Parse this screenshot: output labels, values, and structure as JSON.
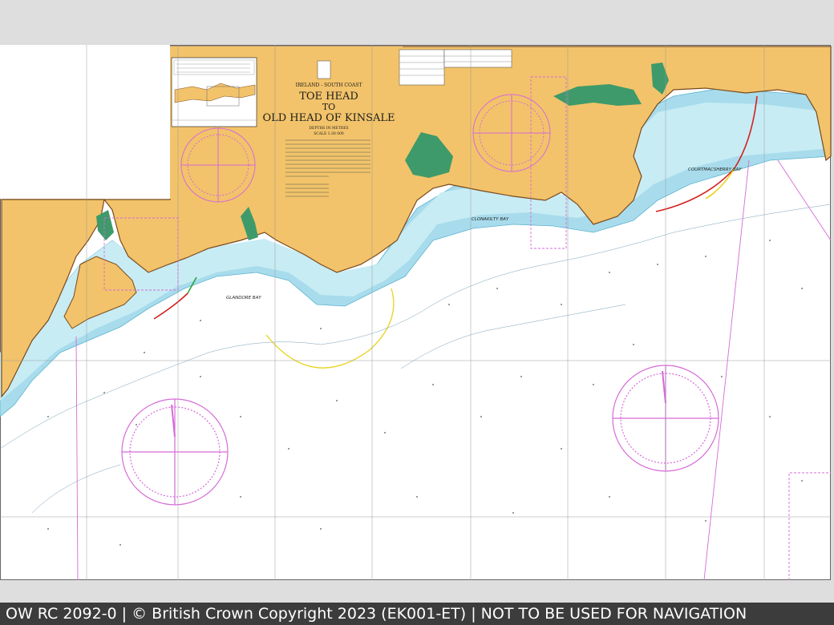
{
  "chart_sheet": {
    "region": "IRELAND - SOUTH COAST",
    "title_line1": "TOE HEAD",
    "title_line2": "TO",
    "title_line3": "OLD HEAD OF KINSALE",
    "depths": "DEPTHS IN METRES",
    "scale": "SCALE 1:30 000"
  },
  "places": {
    "glandore_bay": "GLANDORE BAY",
    "clonakilty_bay": "CLONAKILTY BAY",
    "courtmacsherry_bay": "COURTMACSHERRY BAY"
  },
  "footer": {
    "text": "OW RC 2092-0 | © British Crown Copyright 2023 (EK001-ET) | NOT TO BE USED FOR NAVIGATION"
  },
  "colors": {
    "land": "#f2c36a",
    "coast": "#7a4a1d",
    "shallow": "#a8dcec",
    "drying": "#3e9a6a",
    "sea": "#ffffff",
    "compass": "#d66ad8",
    "grid": "#9a9a9a"
  }
}
